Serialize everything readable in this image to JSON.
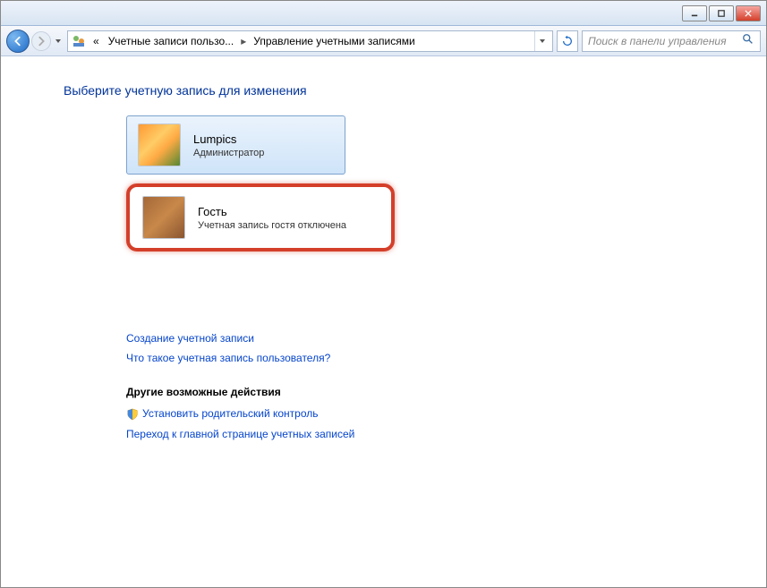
{
  "breadcrumb": {
    "prefix": "«",
    "item1": "Учетные записи пользо...",
    "item2": "Управление учетными записями"
  },
  "search": {
    "placeholder": "Поиск в панели управления"
  },
  "page": {
    "title": "Выберите учетную запись для изменения"
  },
  "accounts": [
    {
      "name": "Lumpics",
      "role": "Администратор"
    },
    {
      "name": "Гость",
      "role": "Учетная запись гостя отключена"
    }
  ],
  "links": {
    "create_account": "Создание учетной записи",
    "what_is_account": "Что такое учетная запись пользователя?",
    "other_actions_heading": "Другие возможные действия",
    "parental_control": "Установить родительский контроль",
    "goto_main": "Переход к главной странице учетных записей"
  }
}
